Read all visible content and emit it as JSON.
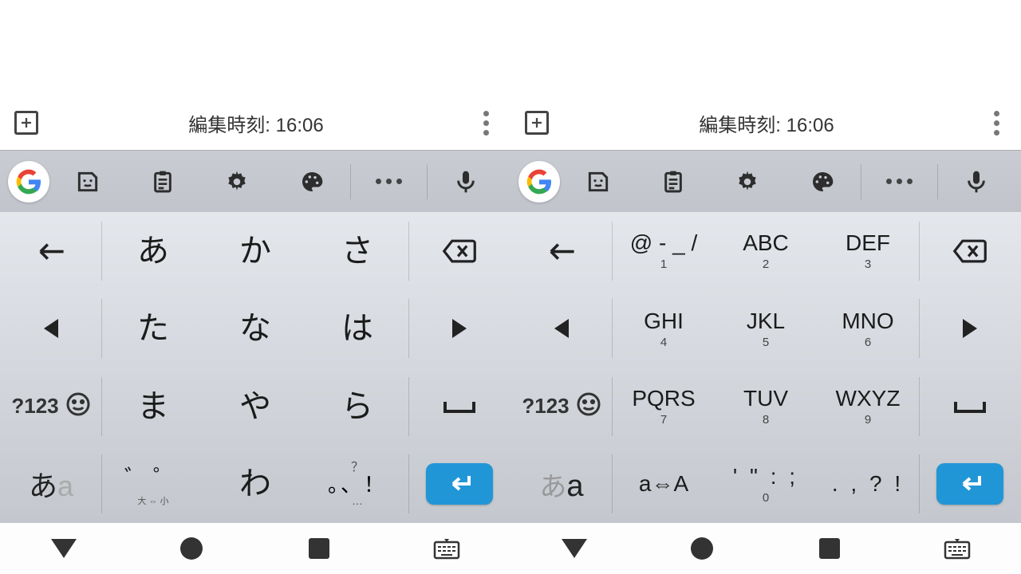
{
  "timestamp": "編集時刻: 16:06",
  "sym123": "?123",
  "left": {
    "mode_a": "あ",
    "mode_b": "a",
    "r1": [
      "あ",
      "か",
      "さ"
    ],
    "r2": [
      "た",
      "な",
      "は"
    ],
    "r3": [
      "ま",
      "や",
      "ら"
    ],
    "r4_dakuten": "゛゜",
    "r4_dakuten_sub": "大 ⇔ 小",
    "r4_wa": "わ",
    "r4_punc_top": "？",
    "r4_punc_main": "。、！",
    "r4_punc_sub": "…"
  },
  "right": {
    "mode_a": "あ",
    "mode_b": "a",
    "k1": {
      "m": "@ - _ /",
      "s": "1"
    },
    "k2": {
      "m": "ABC",
      "s": "2"
    },
    "k3": {
      "m": "DEF",
      "s": "3"
    },
    "k4": {
      "m": "GHI",
      "s": "4"
    },
    "k5": {
      "m": "JKL",
      "s": "5"
    },
    "k6": {
      "m": "MNO",
      "s": "6"
    },
    "k7": {
      "m": "PQRS",
      "s": "7"
    },
    "k8": {
      "m": "TUV",
      "s": "8"
    },
    "k9": {
      "m": "WXYZ",
      "s": "9"
    },
    "kA": {
      "m": "a⇔A",
      "s": ""
    },
    "k0": {
      "m": "' \" : ;",
      "s": "0"
    },
    "kP": {
      "m": ". , ? !",
      "s": ""
    }
  }
}
